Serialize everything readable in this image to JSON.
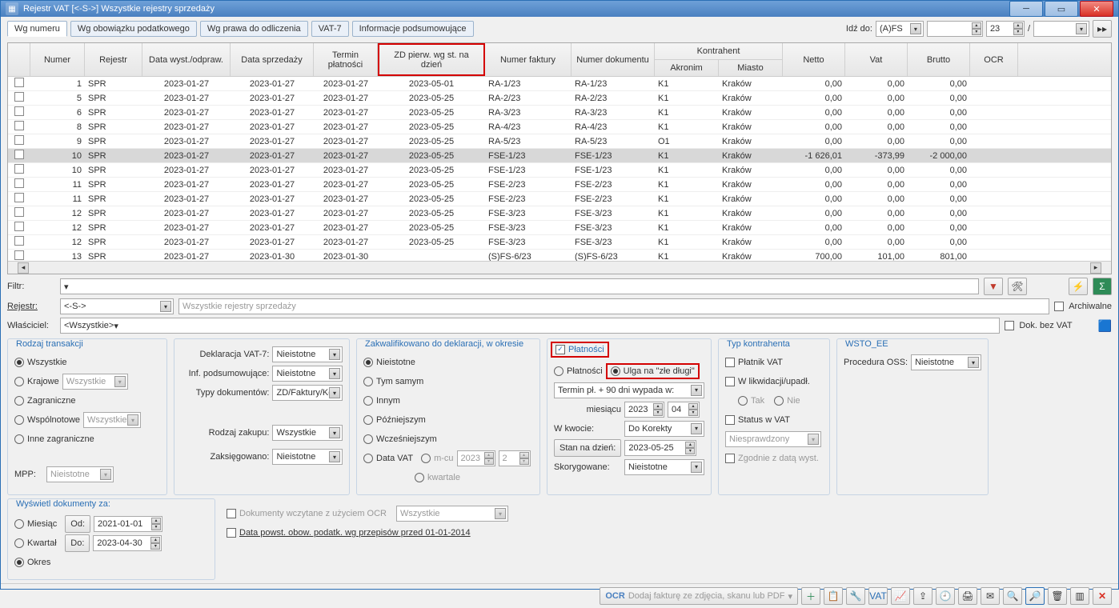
{
  "window": {
    "title": "Rejestr VAT  [<-S->]   Wszystkie rejestry sprzedaży"
  },
  "tabs": [
    "Wg numeru",
    "Wg obowiązku podatkowego",
    "Wg prawa do odliczenia",
    "VAT-7",
    "Informacje podsumowujące"
  ],
  "goto": {
    "label": "Idź do:",
    "combo": "(A)FS",
    "num": "23",
    "sep": "/"
  },
  "thead": {
    "numer": "Numer",
    "rejestr": "Rejestr",
    "datawyst": "Data wyst./odpraw.",
    "datasprz": "Data sprzedaży",
    "termin": "Termin płatności",
    "zd": "ZD pierw. wg st. na dzień",
    "nf": "Numer faktury",
    "nd": "Numer dokumentu",
    "kontrahent": "Kontrahent",
    "akronim": "Akronim",
    "miasto": "Miasto",
    "netto": "Netto",
    "vat": "Vat",
    "brutto": "Brutto",
    "ocr": "OCR"
  },
  "rows": [
    {
      "n": "1",
      "r": "SPR",
      "d1": "2023-01-27",
      "d2": "2023-01-27",
      "d3": "2023-01-27",
      "zd": "2023-05-01",
      "nf": "RA-1/23",
      "nd": "RA-1/23",
      "ak": "K1",
      "mi": "Kraków",
      "ne": "0,00",
      "va": "0,00",
      "br": "0,00"
    },
    {
      "n": "5",
      "r": "SPR",
      "d1": "2023-01-27",
      "d2": "2023-01-27",
      "d3": "2023-01-27",
      "zd": "2023-05-25",
      "nf": "RA-2/23",
      "nd": "RA-2/23",
      "ak": "K1",
      "mi": "Kraków",
      "ne": "0,00",
      "va": "0,00",
      "br": "0,00"
    },
    {
      "n": "6",
      "r": "SPR",
      "d1": "2023-01-27",
      "d2": "2023-01-27",
      "d3": "2023-01-27",
      "zd": "2023-05-25",
      "nf": "RA-3/23",
      "nd": "RA-3/23",
      "ak": "K1",
      "mi": "Kraków",
      "ne": "0,00",
      "va": "0,00",
      "br": "0,00"
    },
    {
      "n": "8",
      "r": "SPR",
      "d1": "2023-01-27",
      "d2": "2023-01-27",
      "d3": "2023-01-27",
      "zd": "2023-05-25",
      "nf": "RA-4/23",
      "nd": "RA-4/23",
      "ak": "K1",
      "mi": "Kraków",
      "ne": "0,00",
      "va": "0,00",
      "br": "0,00"
    },
    {
      "n": "9",
      "r": "SPR",
      "d1": "2023-01-27",
      "d2": "2023-01-27",
      "d3": "2023-01-27",
      "zd": "2023-05-25",
      "nf": "RA-5/23",
      "nd": "RA-5/23",
      "ak": "O1",
      "mi": "Kraków",
      "ne": "0,00",
      "va": "0,00",
      "br": "0,00"
    },
    {
      "n": "10",
      "r": "SPR",
      "d1": "2023-01-27",
      "d2": "2023-01-27",
      "d3": "2023-01-27",
      "zd": "2023-05-25",
      "nf": "FSE-1/23",
      "nd": "FSE-1/23",
      "ak": "K1",
      "mi": "Kraków",
      "ne": "-1 626,01",
      "va": "-373,99",
      "br": "-2 000,00",
      "sel": true
    },
    {
      "n": "10",
      "r": "SPR",
      "d1": "2023-01-27",
      "d2": "2023-01-27",
      "d3": "2023-01-27",
      "zd": "2023-05-25",
      "nf": "FSE-1/23",
      "nd": "FSE-1/23",
      "ak": "K1",
      "mi": "Kraków",
      "ne": "0,00",
      "va": "0,00",
      "br": "0,00"
    },
    {
      "n": "11",
      "r": "SPR",
      "d1": "2023-01-27",
      "d2": "2023-01-27",
      "d3": "2023-01-27",
      "zd": "2023-05-25",
      "nf": "FSE-2/23",
      "nd": "FSE-2/23",
      "ak": "K1",
      "mi": "Kraków",
      "ne": "0,00",
      "va": "0,00",
      "br": "0,00"
    },
    {
      "n": "11",
      "r": "SPR",
      "d1": "2023-01-27",
      "d2": "2023-01-27",
      "d3": "2023-01-27",
      "zd": "2023-05-25",
      "nf": "FSE-2/23",
      "nd": "FSE-2/23",
      "ak": "K1",
      "mi": "Kraków",
      "ne": "0,00",
      "va": "0,00",
      "br": "0,00"
    },
    {
      "n": "12",
      "r": "SPR",
      "d1": "2023-01-27",
      "d2": "2023-01-27",
      "d3": "2023-01-27",
      "zd": "2023-05-25",
      "nf": "FSE-3/23",
      "nd": "FSE-3/23",
      "ak": "K1",
      "mi": "Kraków",
      "ne": "0,00",
      "va": "0,00",
      "br": "0,00"
    },
    {
      "n": "12",
      "r": "SPR",
      "d1": "2023-01-27",
      "d2": "2023-01-27",
      "d3": "2023-01-27",
      "zd": "2023-05-25",
      "nf": "FSE-3/23",
      "nd": "FSE-3/23",
      "ak": "K1",
      "mi": "Kraków",
      "ne": "0,00",
      "va": "0,00",
      "br": "0,00"
    },
    {
      "n": "12",
      "r": "SPR",
      "d1": "2023-01-27",
      "d2": "2023-01-27",
      "d3": "2023-01-27",
      "zd": "2023-05-25",
      "nf": "FSE-3/23",
      "nd": "FSE-3/23",
      "ak": "K1",
      "mi": "Kraków",
      "ne": "0,00",
      "va": "0,00",
      "br": "0,00"
    },
    {
      "n": "13",
      "r": "SPR",
      "d1": "2023-01-27",
      "d2": "2023-01-30",
      "d3": "2023-01-30",
      "zd": "",
      "nf": "(S)FS-6/23",
      "nd": "(S)FS-6/23",
      "ak": "K1",
      "mi": "Kraków",
      "ne": "700,00",
      "va": "101,00",
      "br": "801,00"
    }
  ],
  "filter": {
    "filtr": "Filtr:",
    "rejestr": "Rejestr:",
    "rejval": "<-S->",
    "rejdesc": "Wszystkie rejestry sprzedaży",
    "wlasc": "Właściciel:",
    "wlascval": "<Wszystkie>",
    "arch": "Archiwalne",
    "dokbez": "Dok. bez VAT"
  },
  "p1": {
    "title": "Rodzaj transakcji",
    "wszystkie": "Wszystkie",
    "krajowe": "Krajowe",
    "kcombo": "Wszystkie",
    "zagran": "Zagraniczne",
    "wspol": "Wspólnotowe",
    "wcombo": "Wszystkie",
    "inne": "Inne zagraniczne",
    "mpp": "MPP:",
    "mppval": "Nieistotne"
  },
  "p2": {
    "dekl": "Deklaracja VAT-7:",
    "deklval": "Nieistotne",
    "inf": "Inf. podsumowujące:",
    "infval": "Nieistotne",
    "typy": "Typy dokumentów:",
    "typyval": "ZD/Faktury/Kor",
    "rodzaj": "Rodzaj zakupu:",
    "rodzajval": "Wszystkie",
    "zaks": "Zaksięgowano:",
    "zaksval": "Nieistotne"
  },
  "p3": {
    "title": "Zakwalifikowano do deklaracji, w okresie",
    "nie": "Nieistotne",
    "tym": "Tym samym",
    "inn": "Innym",
    "poz": "Późniejszym",
    "wcz": "Wcześniejszym",
    "dvat": "Data VAT",
    "mcu": "m-cu",
    "kw": "kwartale",
    "yr": "2023",
    "m": "2"
  },
  "p4": {
    "plat": "Płatności",
    "platn": "Płatności",
    "ulga": "Ulga na \"złe długi\"",
    "termin": "Termin pł. + 90 dni wypada w:",
    "mies": "miesiącu",
    "yr": "2023",
    "m": "04",
    "wkw": "W kwocie:",
    "wkwval": "Do Korekty",
    "stan": "Stan na dzień:",
    "stanval": "2023-05-25",
    "skor": "Skorygowane:",
    "skorval": "Nieistotne"
  },
  "p5": {
    "title": "Typ kontrahenta",
    "pvat": "Płatnik VAT",
    "likw": "W likwidacji/upadł.",
    "tak": "Tak",
    "nie": "Nie",
    "stat": "Status w VAT",
    "statval": "Niesprawdzony",
    "zgod": "Zgodnie z datą wyst."
  },
  "p6": {
    "title": "WSTO_EE",
    "proc": "Procedura OSS:",
    "procval": "Nieistotne"
  },
  "p7": {
    "title": "Wyświetl dokumenty za:",
    "mies": "Miesiąc",
    "kw": "Kwartał",
    "okr": "Okres",
    "od": "Od:",
    "odval": "2021-01-01",
    "do": "Do:",
    "doval": "2023-04-30"
  },
  "p8": {
    "ocr": "Dokumenty wczytane z użyciem OCR",
    "ocrval": "Wszystkie",
    "dpow": "Data powst. obow. podatk. wg przepisów przed 01-01-2014"
  },
  "bottom": {
    "hint": "Dodaj fakturę ze zdjęcia, skanu lub PDF",
    "ocr": "OCR"
  }
}
